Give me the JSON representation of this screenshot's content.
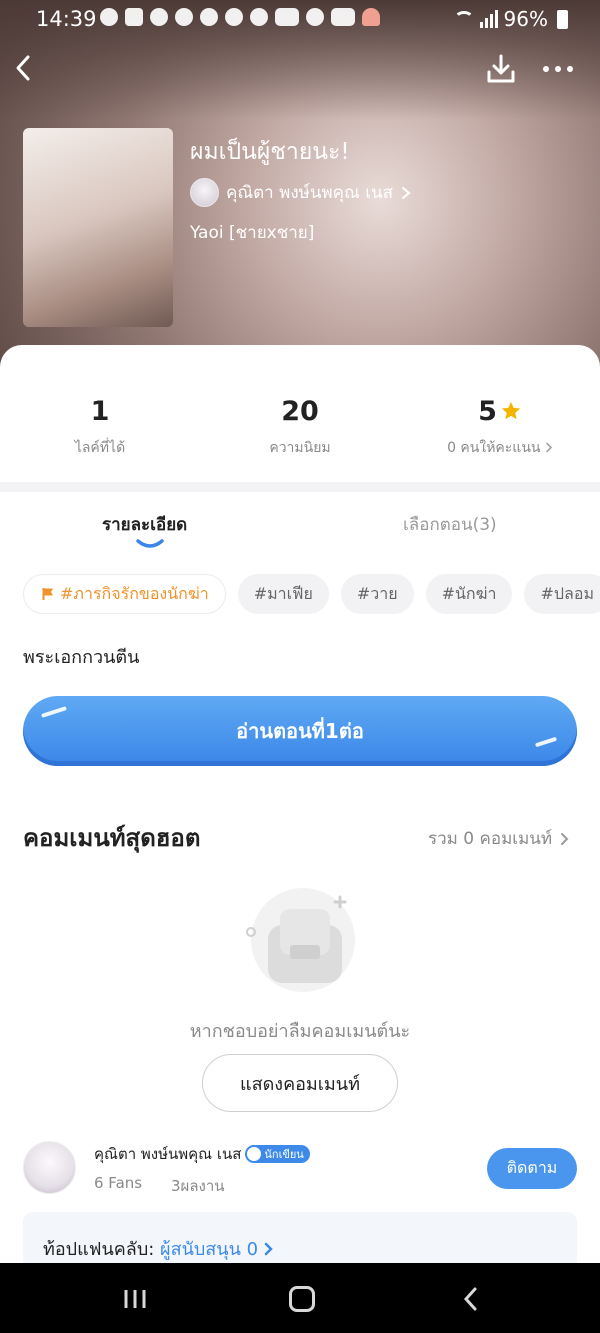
{
  "status_bar": {
    "time": "14:39",
    "battery": "96%"
  },
  "header": {
    "title": "ผมเป็นผู้ชายนะ!",
    "author": "คุณิตา พงษ์นพคุณ เนส",
    "genre": "Yaoi [ชายxชาย]"
  },
  "stats": [
    {
      "value": "1",
      "label": "ไลค์ที่ได้"
    },
    {
      "value": "20",
      "label": "ความนิยม"
    },
    {
      "value": "5",
      "label": "0 คนให้คะแนน"
    }
  ],
  "tabs": {
    "details": "รายละเอียด",
    "episodes": "เลือกตอน(3)"
  },
  "tags": [
    "#ภารกิจรักของนักฆ่า",
    "#มาเฟีย",
    "#วาย",
    "#นักฆ่า",
    "#ปลอม"
  ],
  "synopsis": "พระเอกกวนตีน",
  "read_button": "อ่านตอนที่1ต่อ",
  "comments": {
    "title": "คอมเมนท์สุดฮอต",
    "count_label": "รวม 0 คอมเมนท์",
    "empty_hint": "หากชอบอย่าลืมคอมเมนต์นะ",
    "show_button": "แสดงคอมเมนท์"
  },
  "author_card": {
    "name": "คุณิตา พงษ์นพคุณ เนส",
    "badge": "นักเขียน",
    "fans": "6 Fans",
    "works": "3ผลงาน",
    "follow_button": "ติดตาม"
  },
  "fanclub": {
    "label": "ท้อปแฟนคลับ: ",
    "link": "ผู้สนับสนุน 0"
  },
  "colors": {
    "accent": "#3b86e8",
    "star": "#f5b400",
    "tag_hot": "#f0932b"
  }
}
